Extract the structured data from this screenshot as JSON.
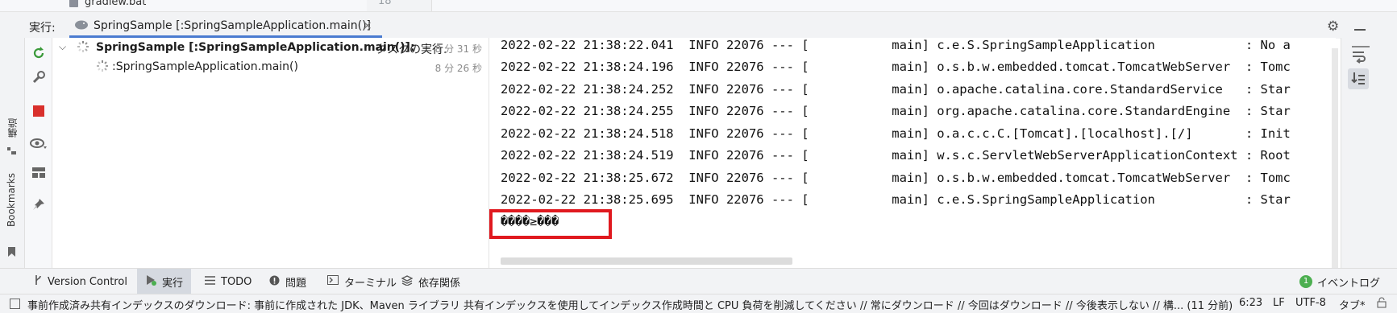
{
  "editor_peek": {
    "file_name": "gradlew.bat",
    "line_number": "18"
  },
  "run_header": {
    "label": "実行:",
    "tab_title": "SpringSample [:SpringSampleApplication.main()]",
    "close_glyph": "×"
  },
  "left_strip": {
    "structure_label": "構造",
    "bookmarks_label": "Bookmarks"
  },
  "tree": {
    "items": [
      {
        "label": "SpringSample [:SpringSampleApplication.main()]:",
        "status": " タスクの実行.",
        "time": "8 分 31 秒"
      },
      {
        "label": ":SpringSampleApplication.main()",
        "time": "8 分 26 秒"
      }
    ]
  },
  "console": {
    "lines": [
      "2022-02-22 21:38:22.041  INFO 22076 --- [           main] c.e.S.SpringSampleApplication            : No a",
      "2022-02-22 21:38:24.196  INFO 22076 --- [           main] o.s.b.w.embedded.tomcat.TomcatWebServer  : Tomc",
      "2022-02-22 21:38:24.252  INFO 22076 --- [           main] o.apache.catalina.core.StandardService   : Star",
      "2022-02-22 21:38:24.255  INFO 22076 --- [           main] org.apache.catalina.core.StandardEngine  : Star",
      "2022-02-22 21:38:24.518  INFO 22076 --- [           main] o.a.c.c.C.[Tomcat].[localhost].[/]       : Init",
      "2022-02-22 21:38:24.519  INFO 22076 --- [           main] w.s.c.ServletWebServerApplicationContext : Root",
      "2022-02-22 21:38:25.672  INFO 22076 --- [           main] o.s.b.w.embedded.tomcat.TomcatWebServer  : Tomc",
      "2022-02-22 21:38:25.695  INFO 22076 --- [           main] c.e.S.SpringSampleApplication            : Star"
    ],
    "garbled": "����≥���",
    "highlight_color": "#e0191f"
  },
  "tool_tabs": {
    "version_control": "Version Control",
    "run": "実行",
    "todo": "TODO",
    "problems": "問題",
    "terminal": "ターミナル",
    "dependencies": "依存関係",
    "event_log": "イベントログ",
    "event_count": "1"
  },
  "status_bar": {
    "message": "事前作成済み共有インデックスのダウンロード: 事前に作成された JDK、Maven ライブラリ 共有インデックスを使用してインデックス作成時間と CPU 負荷を削減してください // 常にダウンロード // 今回はダウンロード // 今後表示しない // 構... (11 分前)",
    "position": "6:23",
    "line_sep": "LF",
    "encoding": "UTF-8",
    "indent": "タブ*"
  }
}
